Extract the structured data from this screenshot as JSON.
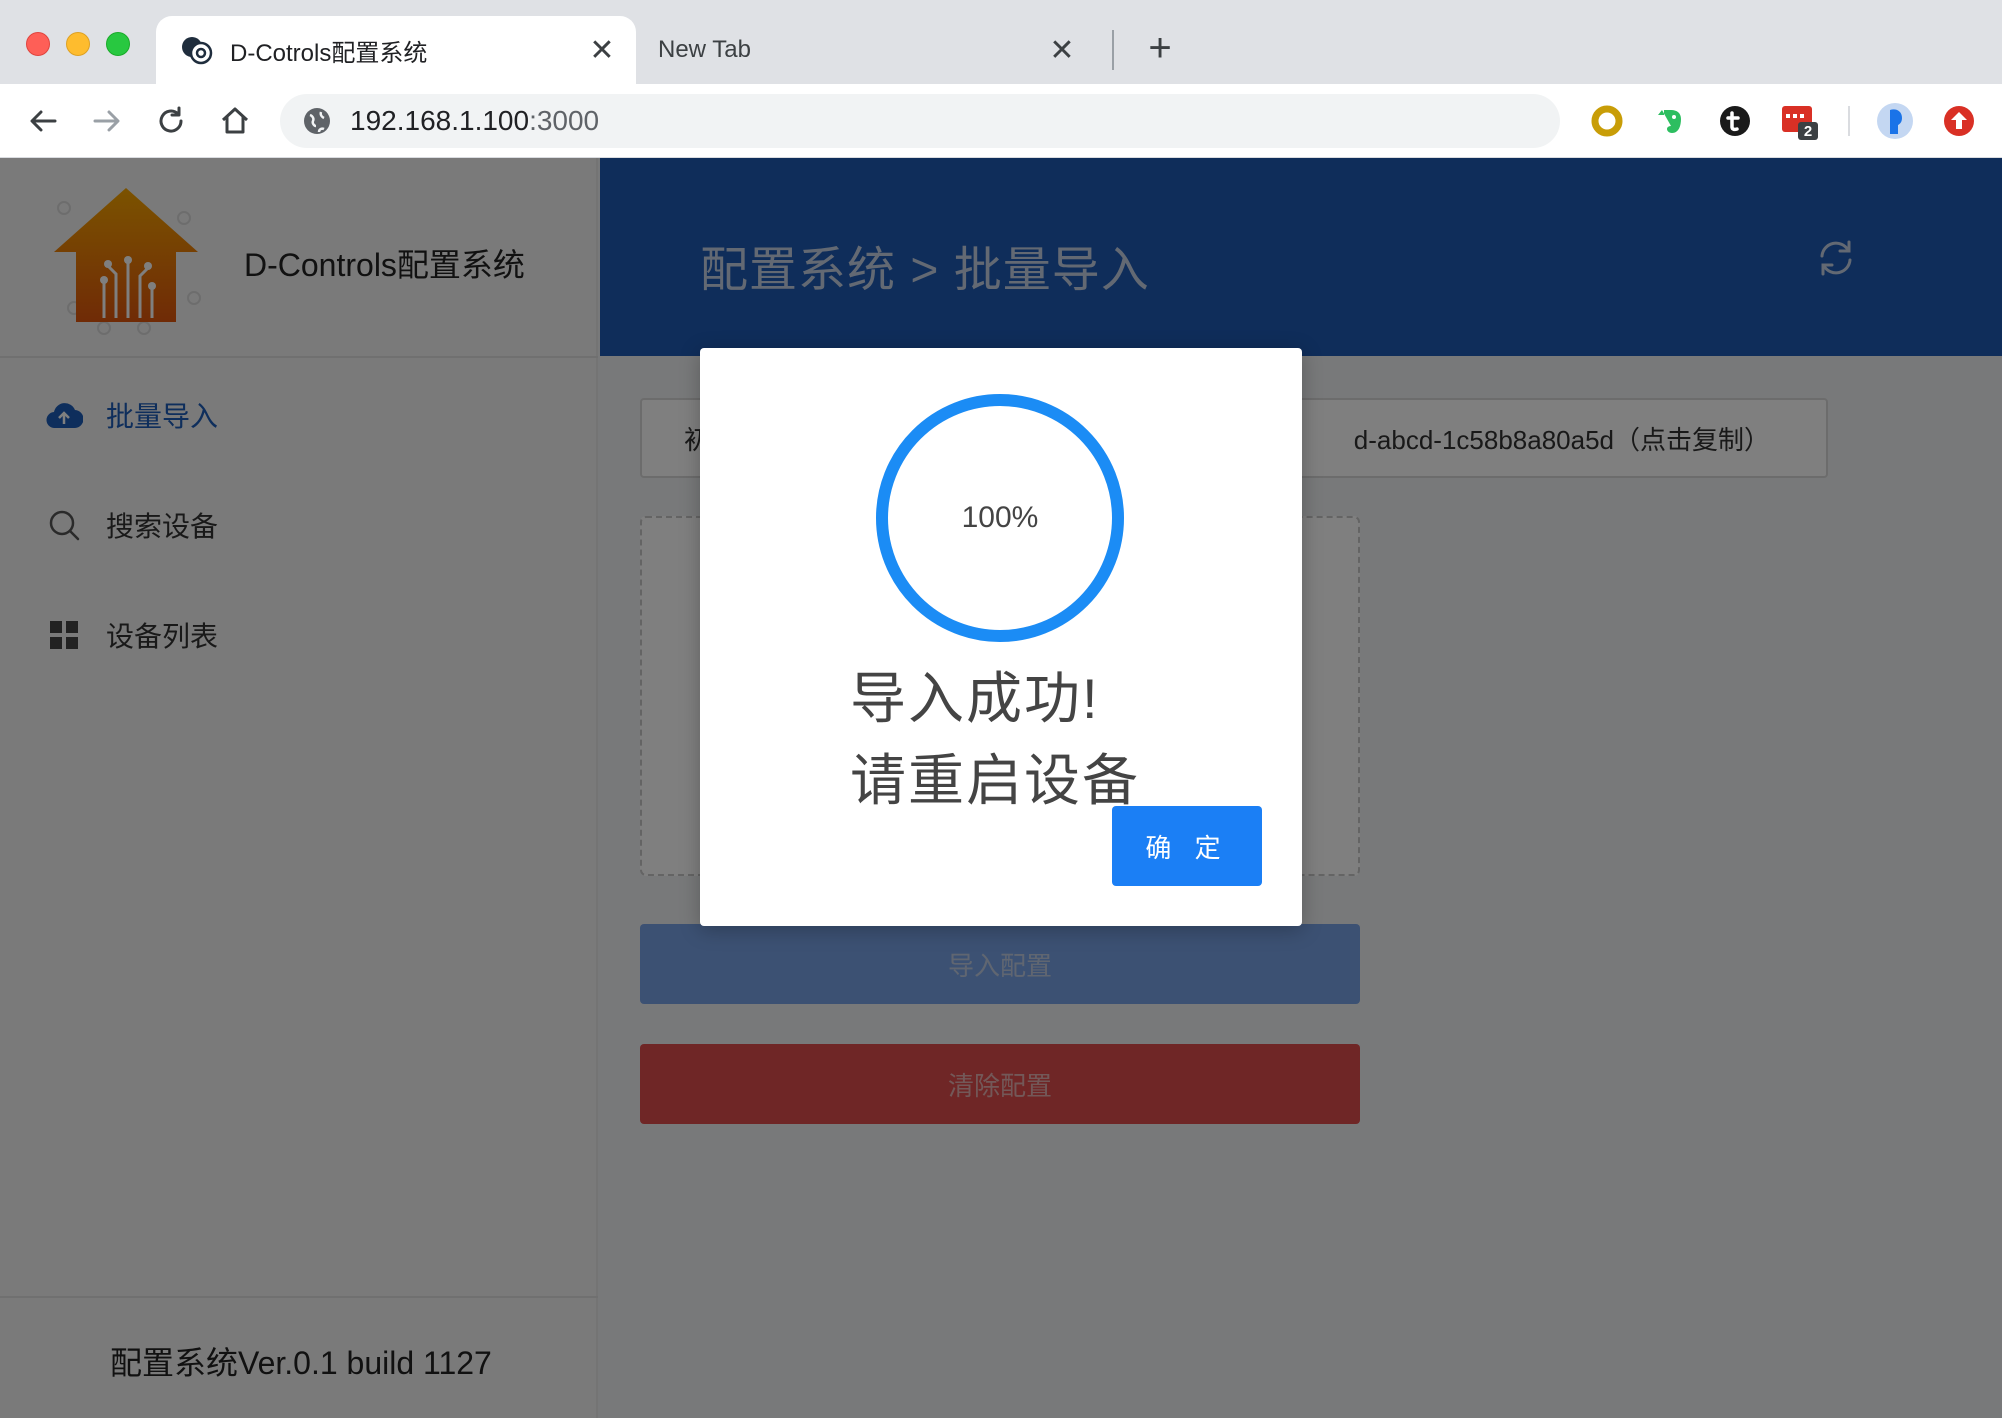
{
  "browser": {
    "tabs": [
      {
        "title": "D-Cotrols配置系统",
        "active": true
      },
      {
        "title": "New Tab",
        "active": false
      }
    ],
    "close_glyph": "✕",
    "new_tab_glyph": "+",
    "url_host": "192.168.1.100",
    "url_port": ":3000",
    "extensions": [
      {
        "icon": "ring-extension-icon",
        "color": "#c89d07"
      },
      {
        "icon": "evernote-icon",
        "color": "#2dbe60"
      },
      {
        "icon": "t-extension-icon",
        "color": "#1a1a1a"
      },
      {
        "icon": "badge-extension-icon",
        "color": "#d93025",
        "badge": "2"
      },
      {
        "icon": "profile-avatar-icon",
        "color": "#1a73e8"
      },
      {
        "icon": "update-icon",
        "color": "#d93025"
      }
    ]
  },
  "app": {
    "brand_name": "D-Controls配置系统",
    "menu": [
      {
        "label": "批量导入",
        "icon": "cloud-upload-icon",
        "active": true
      },
      {
        "label": "搜索设备",
        "icon": "search-icon",
        "active": false
      },
      {
        "label": "设备列表",
        "icon": "grid-icon",
        "active": false
      }
    ],
    "version": "配置系统Ver.0.1 build 1127",
    "breadcrumb": "配置系统 > 批量导入",
    "uuid_prefix": "初",
    "uuid_value": "d-abcd-1c58b8a80a5d（点击复制）",
    "import_button": "导入配置",
    "clear_button": "清除配置",
    "colors": {
      "header": "#1f5bb5",
      "accent": "#1b7ff5",
      "danger": "#de4c4c"
    }
  },
  "modal": {
    "progress_percent": 100,
    "progress_text": "100%",
    "message_line1": "导入成功!",
    "message_line2": "请重启设备",
    "ok_button": "确 定"
  }
}
